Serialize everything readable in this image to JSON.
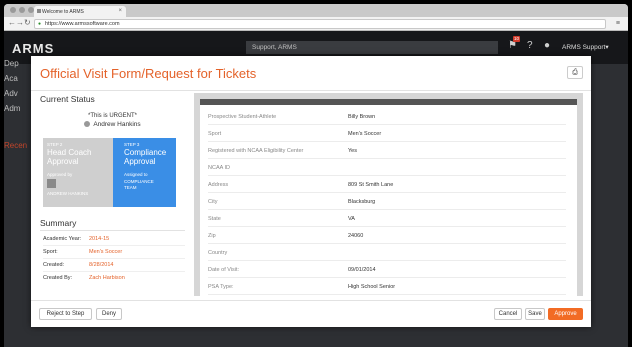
{
  "browser": {
    "tab_title": "Welcome to ARMS",
    "url": "https://www.armssoftware.com",
    "tab_close": "×",
    "back_glyph": "←",
    "forward_glyph": "→",
    "reload_glyph": "↻",
    "menu_glyph": "≡"
  },
  "app": {
    "logo": "ARMS",
    "search_text": "Support, ARMS",
    "notification_count": "10",
    "help_glyph": "?",
    "user_name": "ARMS Support",
    "user_caret": "▾",
    "sidebar_items": [
      "Dep",
      "Aca",
      "Adv",
      "Adm",
      "Recen"
    ],
    "colors": {
      "accent": "#f26b24",
      "title": "#e4622a",
      "step_active": "#3a8ee6"
    }
  },
  "modal": {
    "title": "Official Visit Form/Request for Tickets",
    "print_icon": "⎙",
    "current_status": {
      "title": "Current Status",
      "urgent_text": "*This is URGENT*",
      "assignee": "Andrew Hankins",
      "step2": {
        "number": "STEP 2",
        "name_line1": "Head Coach",
        "name_line2": "Approval",
        "by_label": "Approved by",
        "by_name": "ANDREW HANKINS"
      },
      "step3": {
        "number": "STEP 3",
        "name_line1": "Compliance",
        "name_line2": "Approval",
        "assigned_label": "Assigned to",
        "assigned_line1": "COMPLIANCE",
        "assigned_line2": "TEAM"
      }
    },
    "summary": {
      "title": "Summary",
      "rows": [
        {
          "label": "Academic Year:",
          "value": "2014-15"
        },
        {
          "label": "Sport:",
          "value": "Men's Soccer"
        },
        {
          "label": "Created:",
          "value": "8/28/2014"
        },
        {
          "label": "Created By:",
          "value": "Zach Harbison"
        }
      ]
    },
    "form_fields": [
      {
        "label": "Prospective Student-Athlete",
        "value": "Billy Brown"
      },
      {
        "label": "Sport",
        "value": "Men's Soccer"
      },
      {
        "label": "Registered with NCAA Eligibility Center",
        "value": "Yes"
      },
      {
        "label": "NCAA ID",
        "value": ""
      },
      {
        "label": "Address",
        "value": "809 St Smith Lane"
      },
      {
        "label": "City",
        "value": "Blacksburg"
      },
      {
        "label": "State",
        "value": "VA"
      },
      {
        "label": "Zip",
        "value": "24060"
      },
      {
        "label": "Country",
        "value": ""
      },
      {
        "label": "Date of Visit:",
        "value": "09/01/2014"
      },
      {
        "label": "PSA Type:",
        "value": "High School Senior"
      }
    ],
    "buttons": {
      "reject": "Reject to Step",
      "deny": "Deny",
      "cancel": "Cancel",
      "save": "Save",
      "approve": "Approve"
    }
  }
}
